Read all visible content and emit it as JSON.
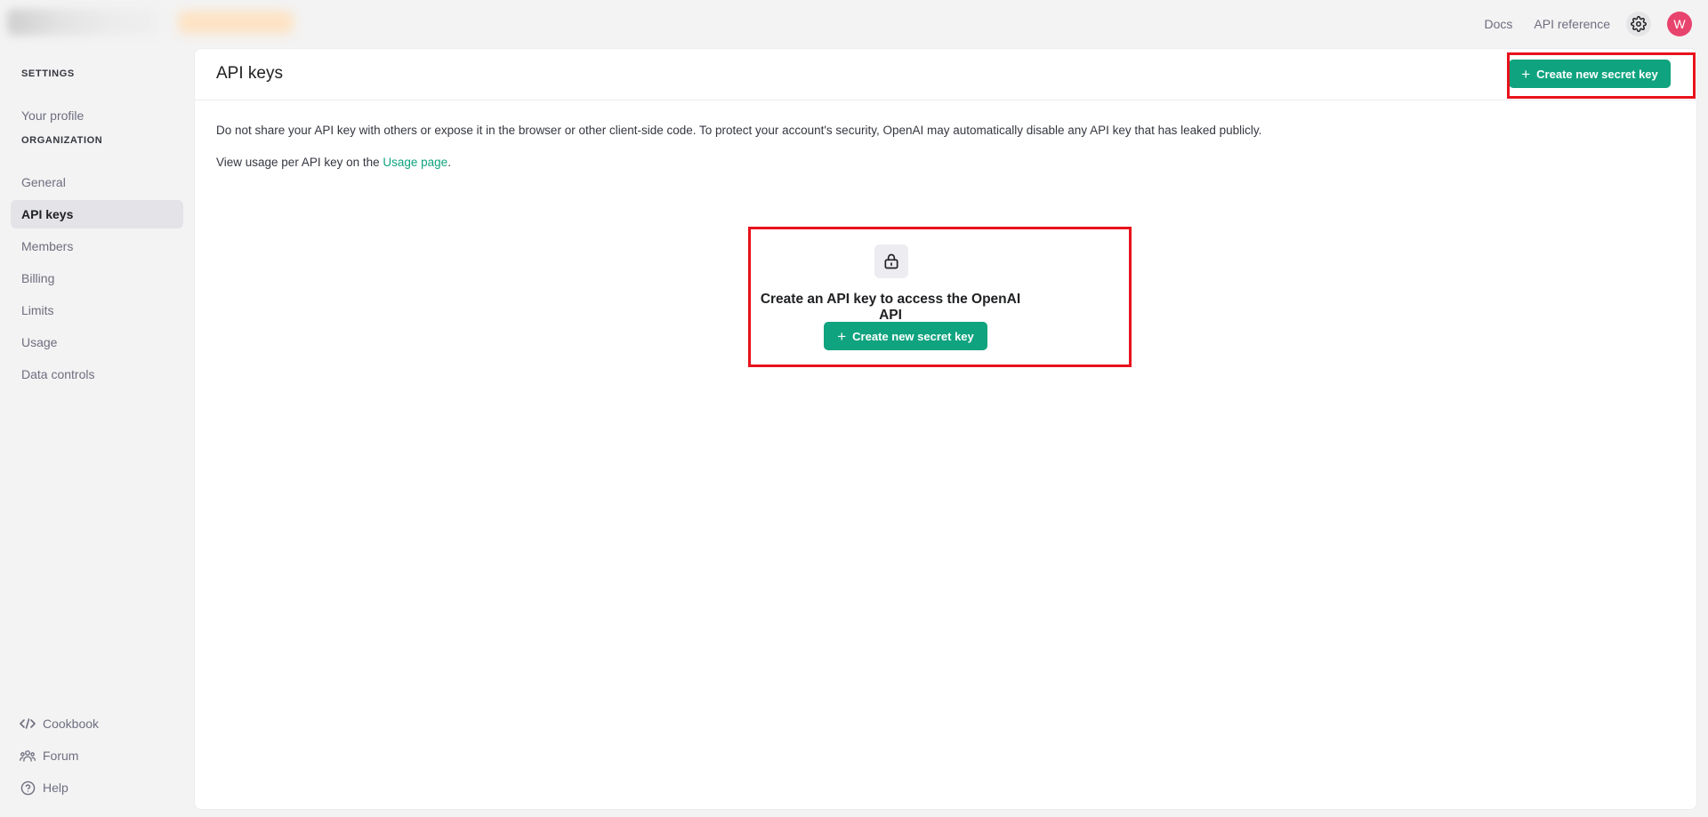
{
  "topbar": {
    "links": [
      "Docs",
      "API reference"
    ],
    "avatar_initial": "W",
    "icons": {
      "settings": "gear-icon"
    }
  },
  "sidebar": {
    "settings_heading": "SETTINGS",
    "settings_items": [
      {
        "label": "Your profile"
      }
    ],
    "organization_heading": "ORGANIZATION",
    "organization_items": [
      {
        "label": "General"
      },
      {
        "label": "API keys",
        "active": true
      },
      {
        "label": "Members"
      },
      {
        "label": "Billing"
      },
      {
        "label": "Limits"
      },
      {
        "label": "Usage"
      },
      {
        "label": "Data controls"
      }
    ],
    "footer_items": [
      {
        "label": "Cookbook",
        "icon": "code-icon"
      },
      {
        "label": "Forum",
        "icon": "people-icon"
      },
      {
        "label": "Help",
        "icon": "help-circle-icon"
      }
    ]
  },
  "main": {
    "title": "API keys",
    "header_button": "Create new secret key",
    "notice": "Do not share your API key with others or expose it in the browser or other client-side code. To protect your account's security, OpenAI may automatically disable any API key that has leaked publicly.",
    "usage_prefix": "View usage per API key on the ",
    "usage_link": "Usage page",
    "usage_suffix": ".",
    "empty_state": {
      "icon": "lock-icon",
      "title": "Create an API key to access the OpenAI API",
      "button": "Create new secret key"
    }
  },
  "colors": {
    "accent": "#10a37f",
    "avatar": "#e8436d",
    "highlight": "#e8121c"
  }
}
